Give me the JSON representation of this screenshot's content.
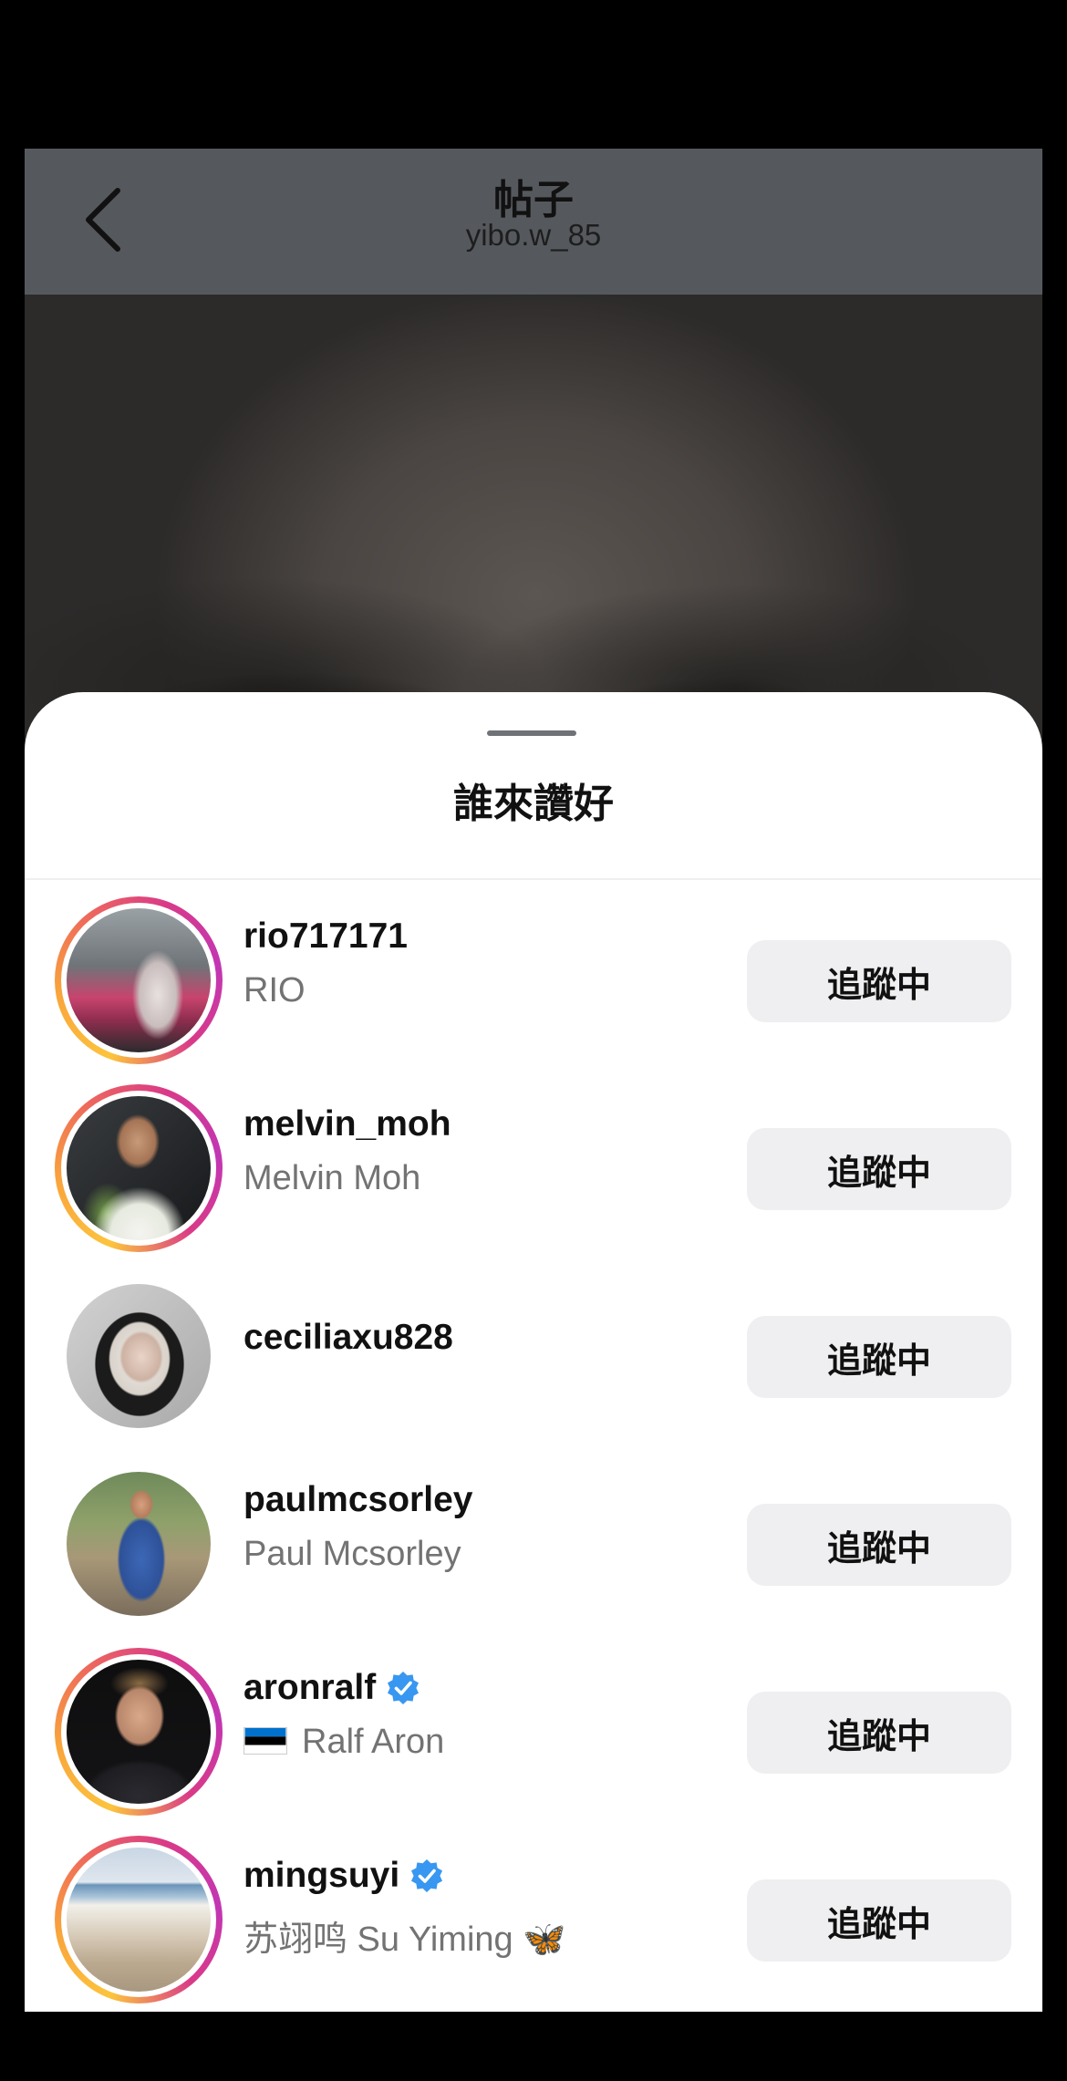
{
  "header": {
    "title": "帖子",
    "subtitle": "yibo.w_85"
  },
  "sheet": {
    "title": "誰來讚好"
  },
  "likes": [
    {
      "username": "rio717171",
      "full_name": "RIO",
      "verified": false,
      "story_ring": true,
      "button": "追蹤中"
    },
    {
      "username": "melvin_moh",
      "full_name": "Melvin Moh",
      "verified": false,
      "story_ring": true,
      "button": "追蹤中"
    },
    {
      "username": "ceciliaxu828",
      "full_name": "",
      "verified": false,
      "story_ring": false,
      "button": "追蹤中"
    },
    {
      "username": "paulmcsorley",
      "full_name": "Paul Mcsorley",
      "verified": false,
      "story_ring": false,
      "button": "追蹤中"
    },
    {
      "username": "aronralf",
      "full_name": "Ralf Aron",
      "flag": "estonia-flag",
      "verified": true,
      "story_ring": true,
      "button": "追蹤中"
    },
    {
      "username": "mingsuyi",
      "full_name": "苏翊鸣 Su Yiming 🦋",
      "verified": true,
      "story_ring": true,
      "button": "追蹤中"
    }
  ],
  "colors": {
    "verified_badge": "#3897f0",
    "button_bg": "#efeff1",
    "secondary_text": "#737373"
  }
}
